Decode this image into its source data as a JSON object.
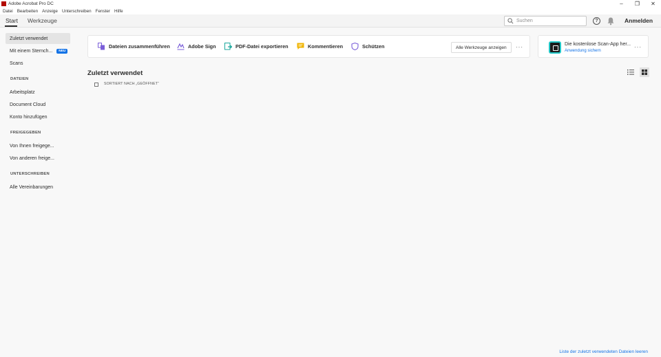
{
  "window": {
    "title": "Adobe Acrobat Pro DC",
    "controls": [
      "–",
      "❐",
      "✕"
    ]
  },
  "menu": [
    "Datei",
    "Bearbeiten",
    "Anzeige",
    "Unterschreiben",
    "Fenster",
    "Hilfe"
  ],
  "tabs": [
    {
      "label": "Start",
      "active": true
    },
    {
      "label": "Werkzeuge",
      "active": false
    }
  ],
  "header": {
    "search_placeholder": "Suchen",
    "help": "?",
    "signin": "Anmelden"
  },
  "sidebar": {
    "recent": "Zuletzt verwendet",
    "stamp": "Mit einem Sternch...",
    "new_badge": "NEU",
    "scans": "Scans",
    "files_head": "DATEIEN",
    "workspace": "Arbeitsplatz",
    "cloud": "Document Cloud",
    "add_account": "Konto hinzufügen",
    "shared_head": "FREIGEGEBEN",
    "by_you": "Von Ihnen freigege...",
    "by_others": "Von anderen freige...",
    "sign_head": "UNTERSCHREIBEN",
    "agreements": "Alle Vereinbarungen"
  },
  "tools": {
    "combine": "Dateien zusammenführen",
    "sign": "Adobe Sign",
    "export": "PDF-Datei exportieren",
    "comment": "Kommentieren",
    "protect": "Schützen",
    "all_tools": "Alle Werkzeuge anzeigen",
    "more": "···"
  },
  "promo": {
    "title": "Die kostenlose Scan-App her...",
    "link": "Anwendung sichern",
    "more": "···"
  },
  "main": {
    "title": "Zuletzt verwendet",
    "sort_label": "SORTIERT NACH „GEÖFFNET“",
    "clear_link": "Liste der zuletzt verwendeten Dateien leeren"
  },
  "colors": {
    "accent": "#1473e6",
    "logo": "#b30b00",
    "promo_border": "#21c7c7"
  }
}
